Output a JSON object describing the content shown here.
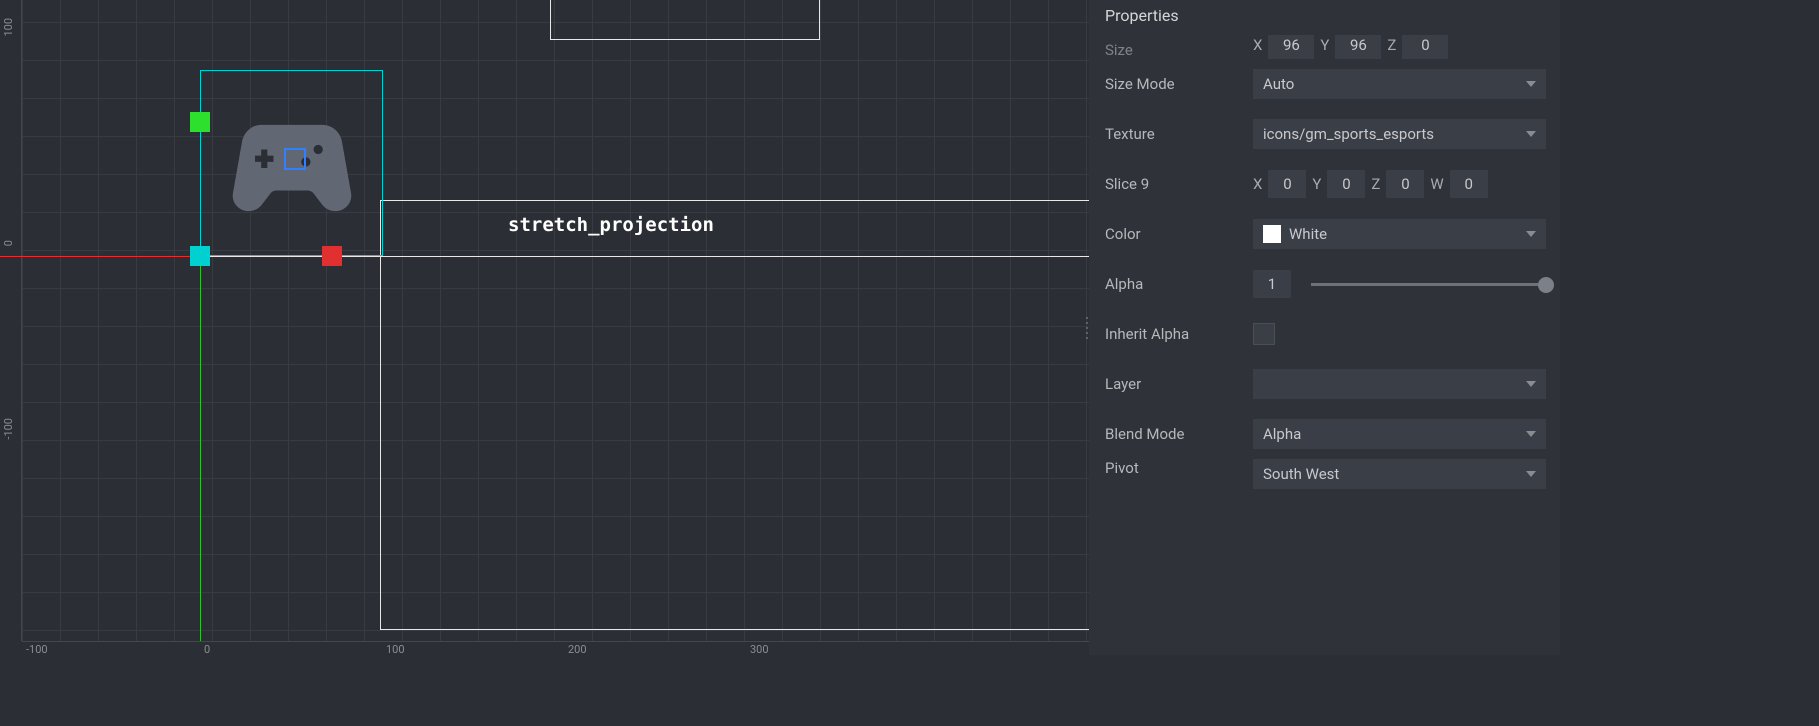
{
  "panel_title": "Properties",
  "node_label": "stretch_projection",
  "ruler_h": {
    "m100": "-100",
    "p0": "0",
    "p100": "100",
    "p200": "200",
    "p300": "300"
  },
  "ruler_v": {
    "m100": "-100",
    "p0": "0",
    "p100": "100"
  },
  "partial": {
    "size_label": "Size",
    "x": "X",
    "y": "Y",
    "z": "Z",
    "xv": "96",
    "yv": "96",
    "zv": "0"
  },
  "props": {
    "size_mode": {
      "label": "Size Mode",
      "value": "Auto"
    },
    "texture": {
      "label": "Texture",
      "value": "icons/gm_sports_esports"
    },
    "slice9": {
      "label": "Slice 9",
      "x": "X",
      "xv": "0",
      "y": "Y",
      "yv": "0",
      "z": "Z",
      "zv": "0",
      "w": "W",
      "wv": "0"
    },
    "color": {
      "label": "Color",
      "value": "White",
      "swatch": "#ffffff"
    },
    "alpha": {
      "label": "Alpha",
      "value": "1"
    },
    "inherit_alpha": {
      "label": "Inherit Alpha"
    },
    "layer": {
      "label": "Layer",
      "value": ""
    },
    "blend": {
      "label": "Blend Mode",
      "value": "Alpha"
    },
    "pivot": {
      "label": "Pivot",
      "value": "South West"
    }
  }
}
